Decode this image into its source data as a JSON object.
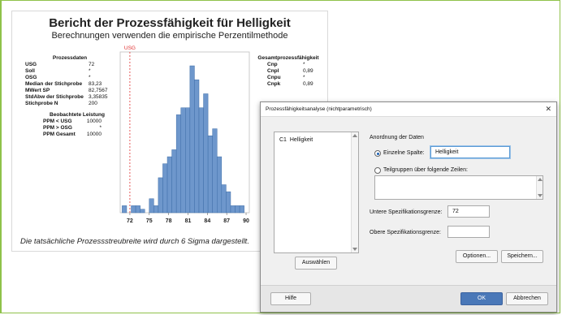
{
  "report": {
    "title": "Bericht der Prozessfähigkeit für Helligkeit",
    "subtitle": "Berechnungen verwenden die empirische Perzentilmethode",
    "prozessdaten": {
      "header": "Prozessdaten",
      "rows": [
        {
          "label": "USG",
          "value": "72"
        },
        {
          "label": "Soll",
          "value": "*"
        },
        {
          "label": "OSG",
          "value": "*"
        },
        {
          "label": "Median der Stichprobe",
          "value": "83,23"
        },
        {
          "label": "MWert SP",
          "value": "82,7567"
        },
        {
          "label": "StdAbw der Stichprobe",
          "value": "3,35835"
        },
        {
          "label": "Stichprobe N",
          "value": "200"
        }
      ]
    },
    "beobachtet": {
      "header": "Beobachtete Leistung",
      "rows": [
        {
          "label": "PPM < USG",
          "value": "10000"
        },
        {
          "label": "PPM > OSG",
          "value": "*"
        },
        {
          "label": "PPM Gesamt",
          "value": "10000"
        }
      ]
    },
    "gesamt": {
      "header": "Gesamtprozessfähigkeit",
      "rows": [
        {
          "label": "Cnp",
          "value": "*"
        },
        {
          "label": "Cnpl",
          "value": "0,89"
        },
        {
          "label": "Cnpu",
          "value": "*"
        },
        {
          "label": "Cnpk",
          "value": "0,89"
        }
      ]
    },
    "footnote": "Die tatsächliche Prozessstreubreite wird durch 6 Sigma dargestellt."
  },
  "chart_data": {
    "type": "bar",
    "title": "",
    "xlabel": "",
    "ylabel": "",
    "x_ticks": [
      "72",
      "75",
      "78",
      "81",
      "84",
      "87",
      "90"
    ],
    "xlim": [
      70.5,
      90.5
    ],
    "bin_width": 0.7,
    "bins_start": 70.8,
    "values": [
      1,
      0,
      1,
      1,
      0.5,
      0,
      2,
      1,
      5,
      7,
      8,
      9,
      14,
      15,
      15,
      21,
      19,
      15,
      17,
      11,
      12,
      8,
      4,
      3,
      1,
      1,
      1
    ],
    "reference_lines": [
      {
        "label": "USG",
        "x": 72,
        "color": "#e03030"
      }
    ],
    "bar_color": "#6e97cc"
  },
  "dialog": {
    "title": "Prozessfähigkeitsanalyse (nichtparametrisch)",
    "close_glyph": "✕",
    "columns": [
      {
        "id": "C1",
        "name": "Helligkeit"
      }
    ],
    "select_button": "Auswählen",
    "data_arrangement": "Anordnung der Daten",
    "single_column_label": "Einzelne Spalte:",
    "single_column_value": "Helligkeit",
    "subgroups_label": "Teilgruppen über folgende Zeilen:",
    "lsl_label": "Untere Spezifikationsgrenze:",
    "lsl_value": "72",
    "usl_label": "Obere Spezifikationsgrenze:",
    "usl_value": "",
    "options_button": "Optionen...",
    "save_button": "Speichern...",
    "help_button": "Hilfe",
    "ok_button": "OK",
    "cancel_button": "Abbrechen"
  }
}
